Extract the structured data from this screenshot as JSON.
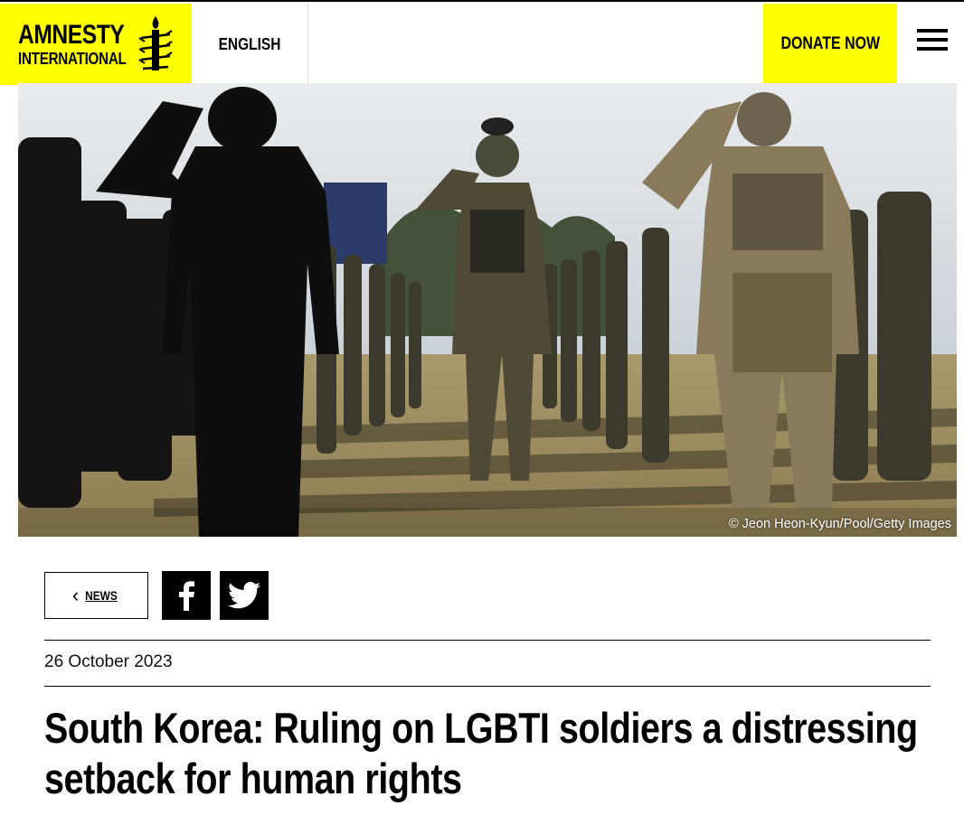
{
  "header": {
    "logo": {
      "line1": "AMNESTY",
      "line2": "INTERNATIONAL",
      "icon": "candle-barbed-wire-icon"
    },
    "language": "ENGLISH",
    "donate": "DONATE NOW",
    "menu_icon": "hamburger-menu-icon",
    "colors": {
      "brand_yellow": "#ffff00",
      "text": "#000000"
    }
  },
  "hero": {
    "credit": "© Jeon Heon-Kyun/Pool/Getty Images"
  },
  "article_nav": {
    "back_label": "NEWS",
    "back_icon": "chevron-left-icon",
    "share": [
      {
        "name": "facebook",
        "icon": "facebook-icon"
      },
      {
        "name": "twitter",
        "icon": "twitter-icon"
      }
    ]
  },
  "article": {
    "date": "26 October 2023",
    "title_line1": "South Korea: Ruling on LGBTI soldiers a distressing",
    "title_line2": "setback for human rights"
  }
}
